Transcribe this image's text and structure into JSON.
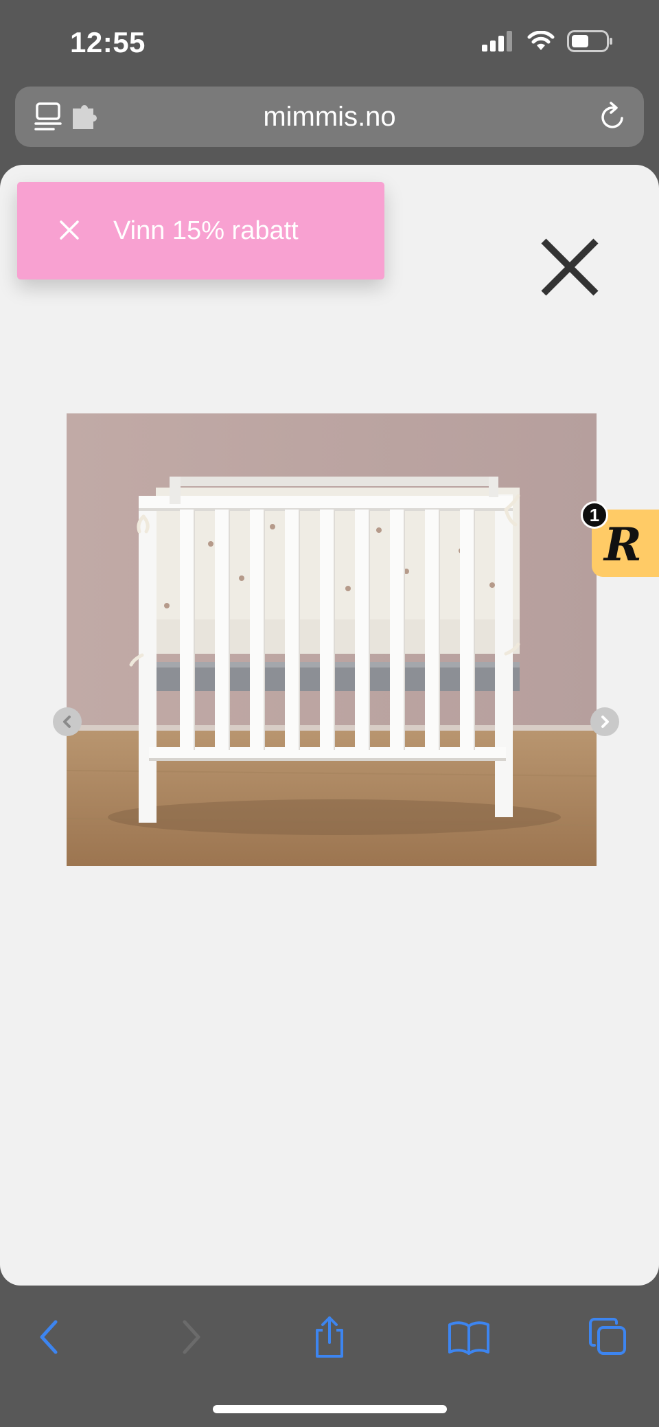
{
  "status_bar": {
    "time": "12:55",
    "icons": [
      "cellular-signal-icon",
      "wifi-icon",
      "battery-icon"
    ]
  },
  "browser": {
    "url": "mimmis.no",
    "left_icons": [
      "reader-mode-icon",
      "extension-icon"
    ],
    "reload_icon": "reload-icon"
  },
  "promo": {
    "label": "Vinn 15% rabatt",
    "close_icon": "close-icon",
    "background": "#f8a1d1"
  },
  "lightbox": {
    "close_icon": "close-icon",
    "prev_icon": "chevron-left-icon",
    "next_icon": "chevron-right-icon",
    "image_subject": "white crib with heart-pattern bumper"
  },
  "rewards": {
    "letter": "R",
    "badge_count": "1",
    "background": "#ffcb66"
  },
  "toolbar": {
    "buttons": [
      "back-icon",
      "forward-icon",
      "share-icon",
      "bookmarks-icon",
      "tabs-icon"
    ],
    "accent": "#3d85f0"
  }
}
